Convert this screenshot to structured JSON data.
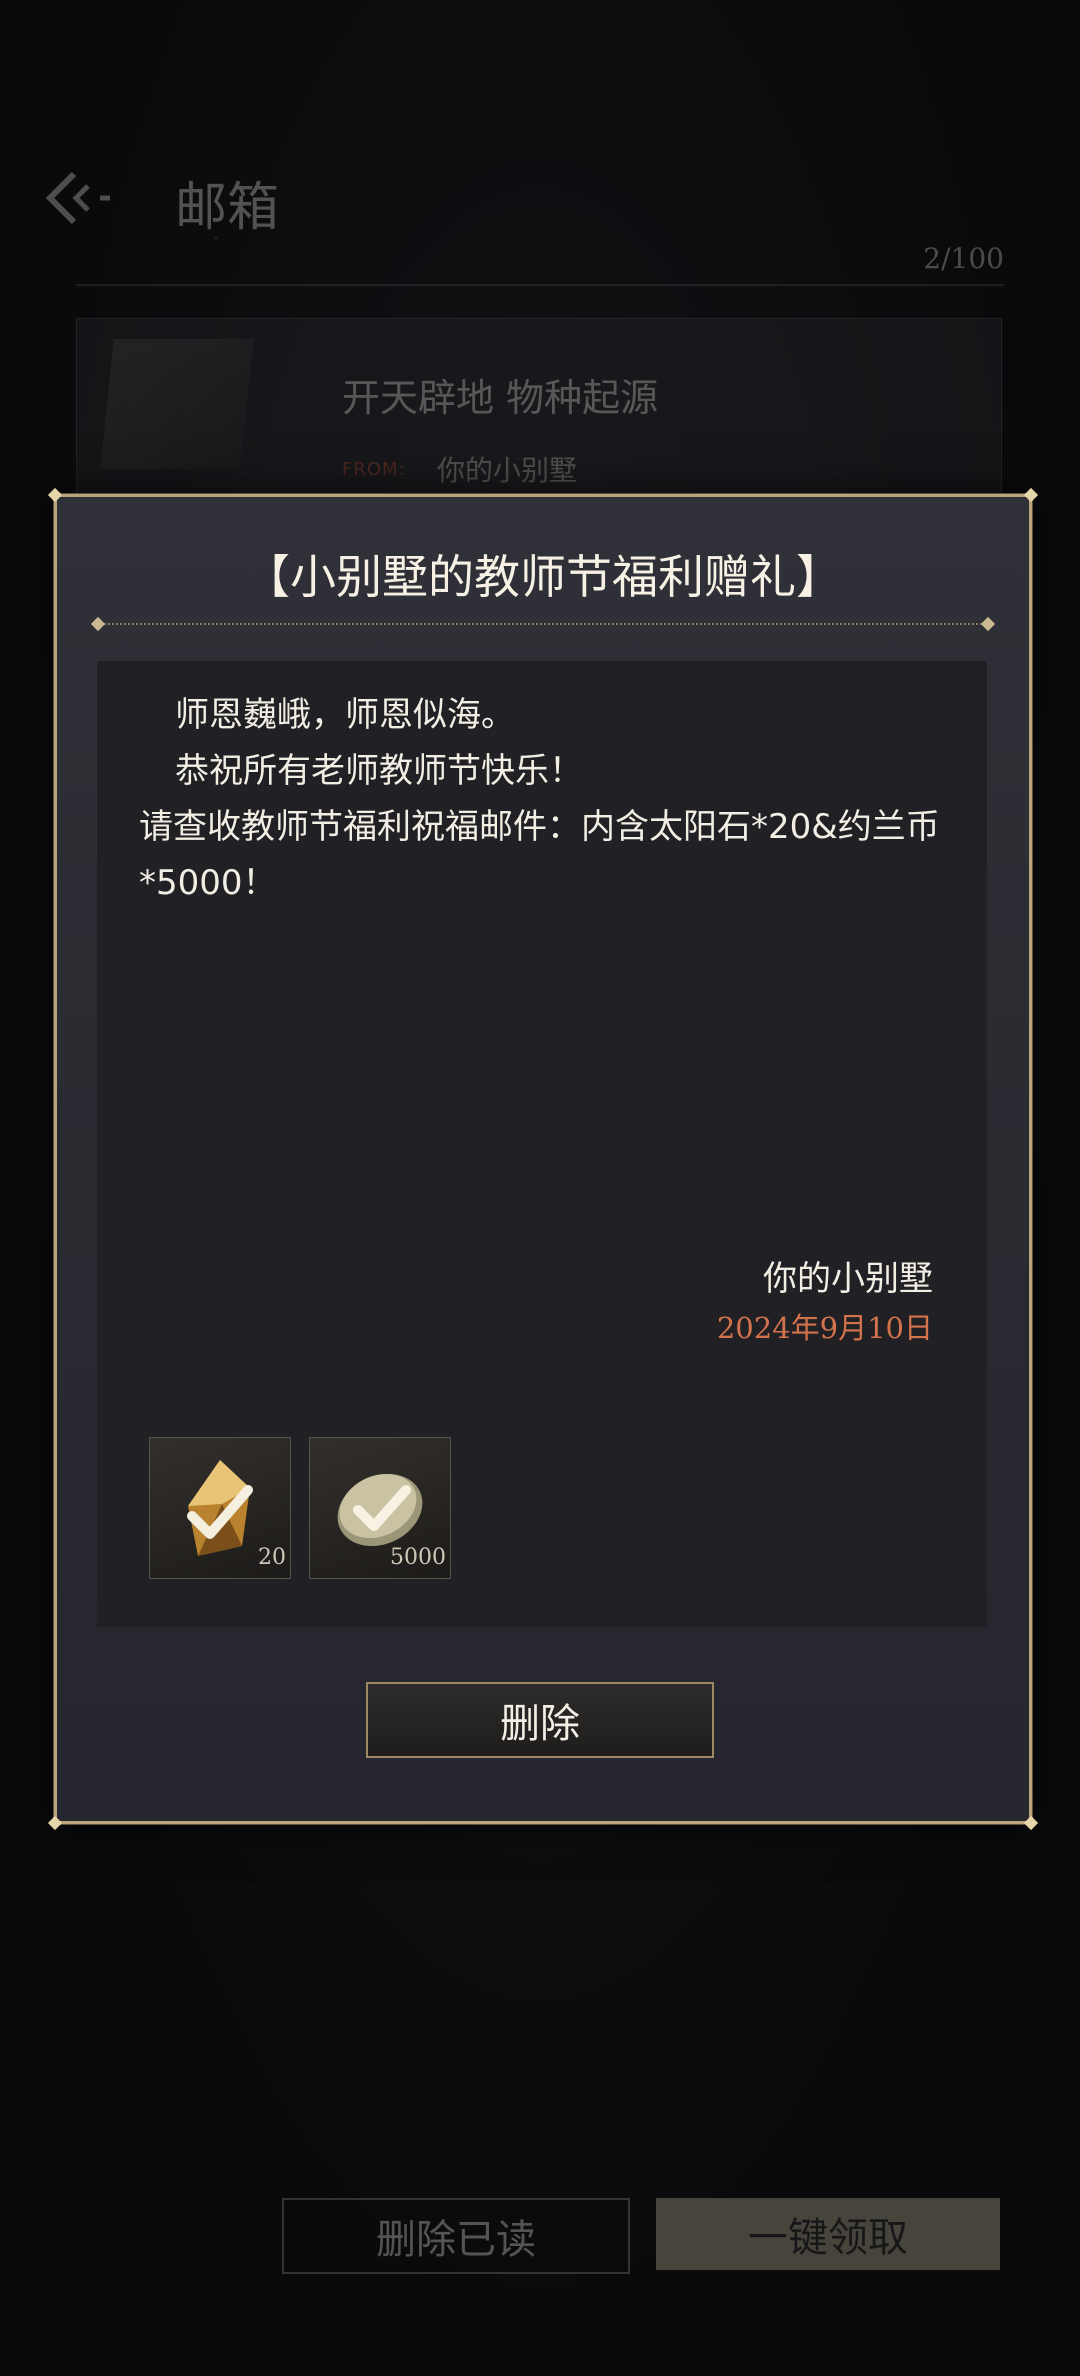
{
  "header": {
    "title": "邮箱",
    "count": "2/100"
  },
  "mail_list": [
    {
      "subject": "开天辟地 物种起源",
      "from_label": "FROM:",
      "from": "你的小别墅"
    }
  ],
  "dialog": {
    "title": "【小别墅的教师节福利赠礼】",
    "body": [
      "师恩巍峨，师恩似海。",
      "恭祝所有老师教师节快乐！",
      "请查收教师节福利祝福邮件：内含太阳石*20&约兰币*5000！"
    ],
    "signature": "你的小别墅",
    "date": "2024年9月10日",
    "rewards": [
      {
        "icon": "sunstone-icon",
        "count": "20",
        "claimed": true
      },
      {
        "icon": "yolan-coin-icon",
        "count": "5000",
        "claimed": true
      }
    ],
    "delete_label": "删除"
  },
  "footer": {
    "delete_read_label": "删除已读",
    "claim_all_label": "一键领取"
  },
  "colors": {
    "accent_gold": "#b9a47c",
    "date": "#d2734c",
    "dialog_bg": "#2a2a31"
  }
}
